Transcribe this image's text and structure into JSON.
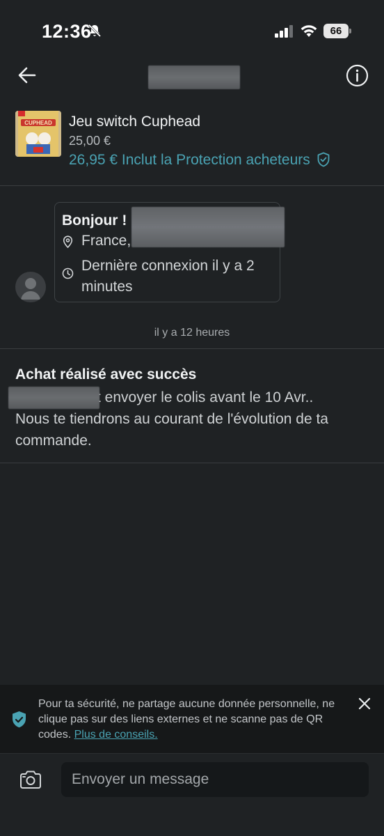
{
  "status_bar": {
    "time": "12:36",
    "battery": "66"
  },
  "header": {
    "back_icon": "arrow-left-icon",
    "info_icon": "info-circle-icon"
  },
  "item": {
    "title": "Jeu switch Cuphead",
    "price": "25,00 €",
    "total_price": "26,95 €",
    "protection_label": "Inclut la Protection acheteurs"
  },
  "greeting": {
    "title": "Bonjour !",
    "location": "France,",
    "last_seen": "Dernière connexion il y a 2 minutes"
  },
  "thread": {
    "timestamp": "il y a 12 heures"
  },
  "purchase": {
    "title": "Achat réalisé avec succès",
    "message_line1": "t envoyer le colis avant le 10 Avr..",
    "message_rest": "Nous te tiendrons au courant de l'évolution de ta commande."
  },
  "safety": {
    "text": "Pour ta sécurité, ne partage aucune donnée personnelle, ne clique pas sur des liens externes et ne scanne pas de QR codes.",
    "link": "Plus de conseils."
  },
  "composer": {
    "placeholder": "Envoyer un message"
  },
  "colors": {
    "background": "#1f2224",
    "accent": "#4aa3b3",
    "banner": "#161819"
  }
}
